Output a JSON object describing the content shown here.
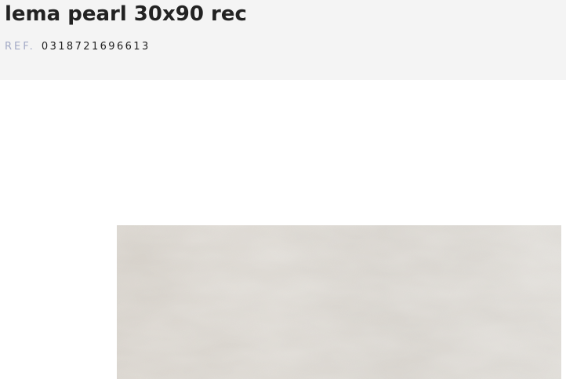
{
  "product": {
    "title": "lema pearl 30x90 rec",
    "ref_label": "REF.",
    "ref_value": "0318721696613"
  },
  "image": {
    "alt": "lema pearl 30x90 rec",
    "tile_color": "#dcd8d2",
    "header_bg": "#f4f4f4",
    "ref_label_color": "#a3aac6"
  }
}
